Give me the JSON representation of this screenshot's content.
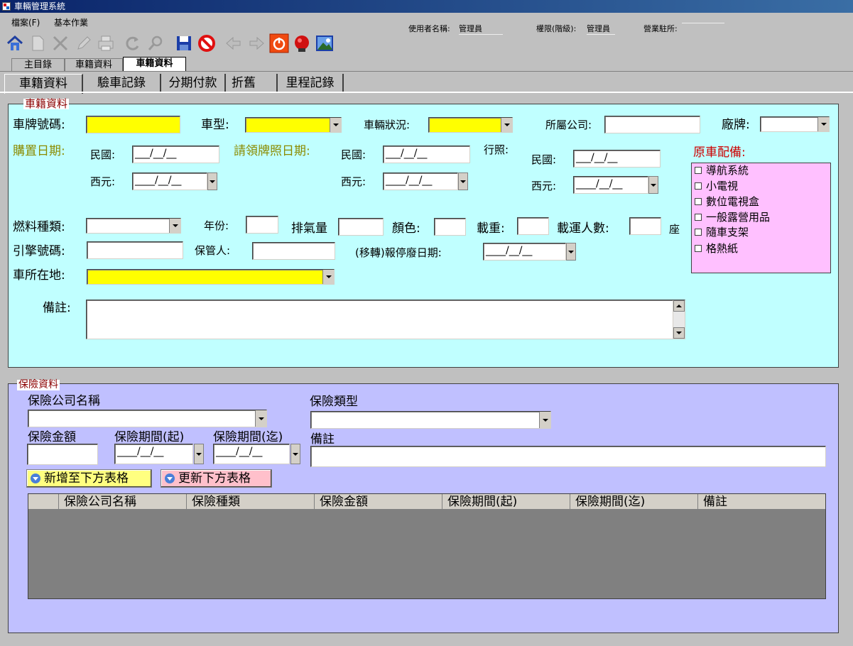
{
  "window": {
    "title": "車輛管理系統"
  },
  "menu": {
    "items": [
      "檔案(F)",
      "基本作業"
    ]
  },
  "status": {
    "user_label": "使用者名稱:",
    "user_value": "管理員",
    "role_label": "權限(階級):",
    "role_value": "管理員",
    "branch_label": "營業駐所:",
    "branch_value": ""
  },
  "toolbar": {
    "icons": [
      "home-icon",
      "new-icon",
      "delete-icon",
      "edit-icon",
      "print-icon",
      "refresh-icon",
      "search-icon",
      "save-icon",
      "cancel-icon",
      "prev-icon",
      "next-icon",
      "power-icon",
      "alarm-icon",
      "picture-icon"
    ]
  },
  "doc_tabs": [
    "主目錄",
    "車籍資料",
    "車籍資料"
  ],
  "sub_tabs": [
    "車籍資料",
    "驗車記錄",
    "分期付款",
    "折舊",
    "里程記錄"
  ],
  "vehicle": {
    "legend": "車籍資料",
    "plate_label": "車牌號碼:",
    "model_label": "車型:",
    "status_label": "車輛狀況:",
    "company_label": "所屬公司:",
    "brand_label": "廠牌:",
    "purchase_date_label": "購置日期:",
    "license_date_label": "請領牌照日期:",
    "license_label": "行照:",
    "roc_label": "民國:",
    "ad_label": "西元:",
    "roc_placeholder": "___/__/__",
    "ad_placeholder": "____/__/__",
    "equip_label": "原車配備:",
    "equipment": [
      "導航系統",
      "小電視",
      "數位電視盒",
      "一般露營用品",
      "隨車支架",
      "格熱紙"
    ],
    "fuel_label": "燃料種類:",
    "year_label": "年份:",
    "displacement_label": "排氣量",
    "color_label": "顏色:",
    "load_label": "載重:",
    "passengers_label": "載運人數:",
    "seats_unit": "座",
    "engine_label": "引擎號碼:",
    "keeper_label": "保管人:",
    "scrap_label": "(移轉)報停廢日期:",
    "location_label": "車所在地:",
    "note_label": "備註:"
  },
  "insurance": {
    "legend": "保險資料",
    "company_label": "保險公司名稱",
    "type_label": "保險類型",
    "amount_label": "保險金額",
    "start_label": "保險期間(起)",
    "end_label": "保險期間(迄)",
    "note_label": "備註",
    "date_placeholder": "____/__/__",
    "add_button": "新增至下方表格",
    "update_button": "更新下方表格",
    "grid_columns": [
      "保險公司名稱",
      "保險種類",
      "保險金額",
      "保險期間(起)",
      "保險期間(迄)",
      "備註"
    ]
  },
  "colors": {
    "required": "#ffff00",
    "vehicle_panel": "#c0ffff",
    "insurance_panel": "#c0c0ff",
    "equip_list": "#ffc0ff",
    "add_button": "#ffff80",
    "update_button": "#ffc0cb"
  }
}
